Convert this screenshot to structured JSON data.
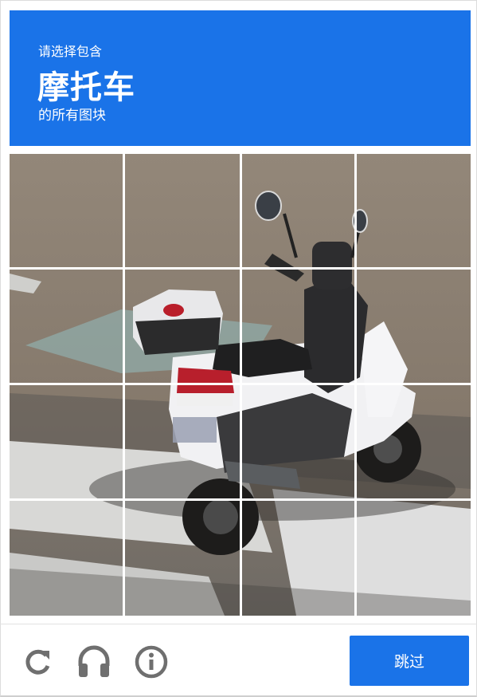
{
  "header": {
    "instruction_prefix": "请选择包含",
    "target_object": "摩托车",
    "instruction_suffix": "的所有图块",
    "background_color": "#1a73e8"
  },
  "grid": {
    "rows": 4,
    "columns": 4,
    "image_subject": "motorcycle"
  },
  "footer": {
    "reload_icon": "reload-icon",
    "audio_icon": "headphones-icon",
    "info_icon": "info-icon",
    "skip_label": "跳过"
  },
  "colors": {
    "accent": "#1a73e8",
    "icon_gray": "#6f6f6f"
  }
}
